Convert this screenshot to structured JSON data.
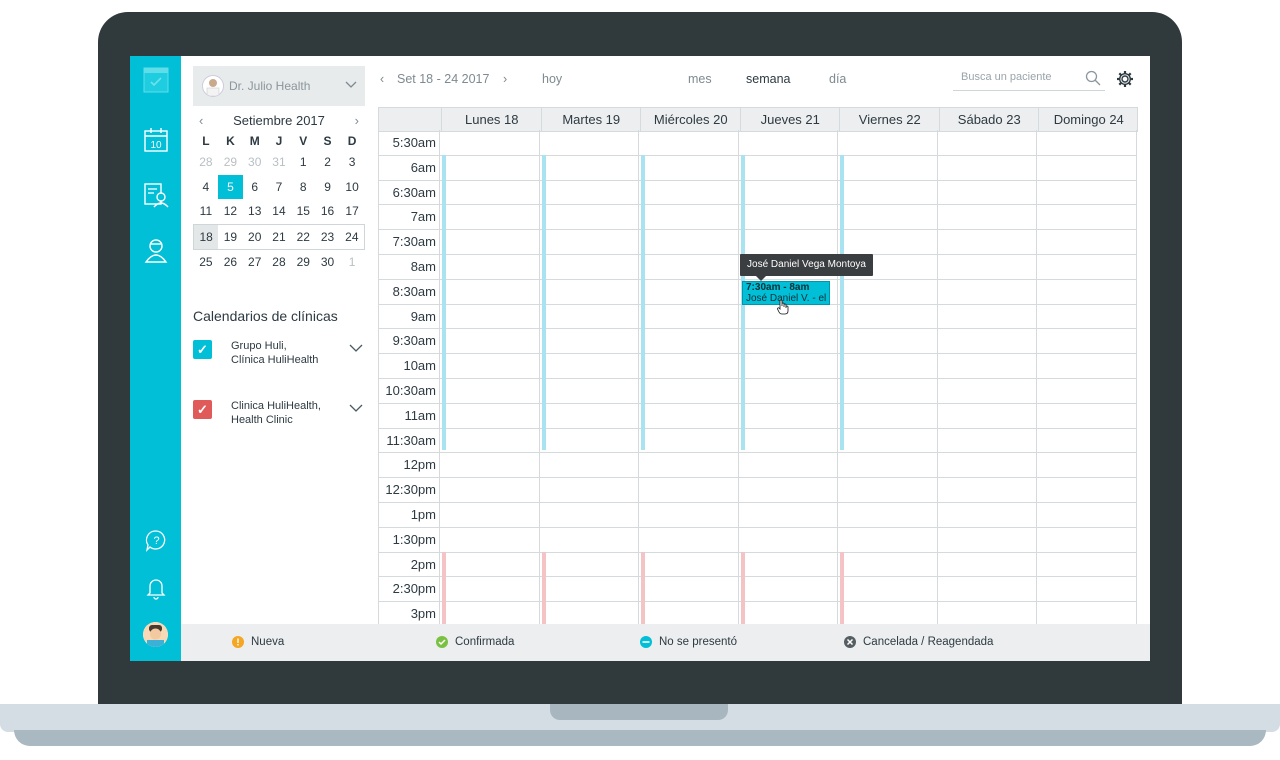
{
  "doctor": {
    "name": "Dr. Julio Health"
  },
  "toolbar": {
    "week_range": "Set 18 - 24 2017",
    "today": "hoy",
    "views": [
      "mes",
      "semana",
      "día"
    ],
    "active_view": "semana",
    "search_placeholder": "Busca un paciente"
  },
  "mini_calendar": {
    "month": "Setiembre 2017",
    "weekdays": [
      "L",
      "K",
      "M",
      "J",
      "V",
      "S",
      "D"
    ],
    "weeks": [
      [
        "28",
        "29",
        "30",
        "31",
        "1",
        "2",
        "3"
      ],
      [
        "4",
        "5",
        "6",
        "7",
        "8",
        "9",
        "10"
      ],
      [
        "11",
        "12",
        "13",
        "14",
        "15",
        "16",
        "17"
      ],
      [
        "18",
        "19",
        "20",
        "21",
        "22",
        "23",
        "24"
      ],
      [
        "25",
        "26",
        "27",
        "28",
        "29",
        "30",
        "1"
      ]
    ],
    "selected_day": "5",
    "highlighted_week_index": 3
  },
  "clinics": {
    "title": "Calendarios de clínicas",
    "items": [
      {
        "label": "Grupo Huli, Clínica HuliHealth",
        "color": "#00bfd6",
        "checked": true
      },
      {
        "label": "Clinica HuliHealth, Health Clinic",
        "color": "#e05a5a",
        "checked": true
      }
    ]
  },
  "calendar": {
    "days": [
      "Lunes 18",
      "Martes 19",
      "Miércoles 20",
      "Jueves 21",
      "Viernes 22",
      "Sábado 23",
      "Domingo 24"
    ],
    "times": [
      "5:30am",
      "6am",
      "6:30am",
      "7am",
      "7:30am",
      "8am",
      "8:30am",
      "9am",
      "9:30am",
      "10am",
      "10:30am",
      "11am",
      "11:30am",
      "12pm",
      "12:30pm",
      "1pm",
      "1:30pm",
      "2pm",
      "2:30pm",
      "3pm"
    ],
    "event": {
      "time": "7:30am - 8am",
      "patient": "José Daniel V. - el",
      "day": "Jueves 21"
    },
    "tooltip": "José Daniel Vega Montoya",
    "availability_colors": {
      "morning": "#a9e3f2",
      "afternoon": "#f4c3c6"
    }
  },
  "legend": [
    {
      "label": "Nueva",
      "color": "#f5a623"
    },
    {
      "label": "Confirmada",
      "color": "#7ac143"
    },
    {
      "label": "No se presentó",
      "color": "#00bfd6"
    },
    {
      "label": "Cancelada / Reagendada",
      "color": "#555f63"
    }
  ],
  "icons": [
    "app-logo-icon",
    "calendar-icon",
    "patients-icon",
    "doctor-profile-icon",
    "help-icon",
    "bell-icon",
    "user-avatar-icon",
    "search-icon",
    "gear-icon"
  ]
}
